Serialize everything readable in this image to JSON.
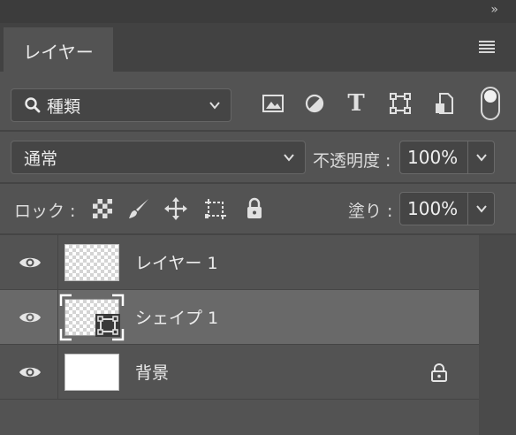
{
  "panel": {
    "collapse_label": "»",
    "tab_label": "レイヤー",
    "menu_icon": "hamburger-icon"
  },
  "filter": {
    "kind_label": "種類",
    "icons": [
      "image-filter-icon",
      "adjustment-filter-icon",
      "type-filter-icon",
      "shape-filter-icon",
      "smart-object-filter-icon"
    ],
    "type_glyph": "T"
  },
  "blend": {
    "mode": "通常",
    "opacity_label": "不透明度 :",
    "opacity_value": "100%"
  },
  "lock": {
    "label": "ロック :",
    "icons": [
      "lock-transparent-icon",
      "lock-paint-icon",
      "lock-position-icon",
      "lock-artboard-icon",
      "lock-all-icon"
    ],
    "fill_label": "塗り :",
    "fill_value": "100%"
  },
  "layers": [
    {
      "name": "レイヤー 1",
      "thumbnail": "transparent",
      "selected": false,
      "locked": false
    },
    {
      "name": "シェイプ 1",
      "thumbnail": "shape",
      "selected": true,
      "locked": false
    },
    {
      "name": "背景",
      "thumbnail": "white",
      "selected": false,
      "locked": true
    }
  ],
  "colors": {
    "panel_bg": "#535353",
    "selected_row": "#696969",
    "field_bg": "#454545"
  }
}
